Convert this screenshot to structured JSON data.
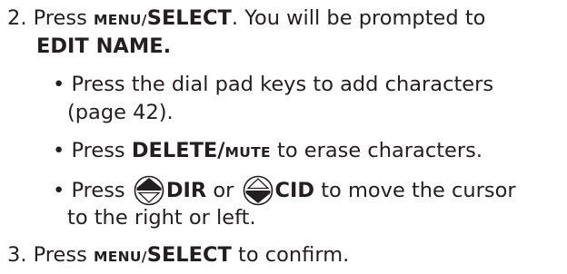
{
  "step2": {
    "number": "2.",
    "text_press": "Press ",
    "key_menu": "MENU/",
    "key_select": "SELECT",
    "text_after": ". You will be prompted to",
    "prompt": "EDIT NAME."
  },
  "bullets": {
    "bullet1_line1": "Press the dial pad keys to add characters",
    "bullet1_line2": "(page 42).",
    "bullet2_press": "Press ",
    "bullet2_key_delete": "DELETE/",
    "bullet2_key_mute": "MUTE",
    "bullet2_after": " to erase characters.",
    "bullet3_press": "Press ",
    "bullet3_dir": "DIR",
    "bullet3_or": " or ",
    "bullet3_cid": "CID",
    "bullet3_after": " to move the cursor",
    "bullet3_line2": "to the right or left."
  },
  "step3": {
    "number": "3.",
    "text_press": "Press ",
    "key_menu": "MENU/",
    "key_select": "SELECT",
    "text_after": " to confirm."
  },
  "icons": {
    "up_key": "up-arrow-key-icon",
    "down_key": "down-arrow-key-icon"
  }
}
